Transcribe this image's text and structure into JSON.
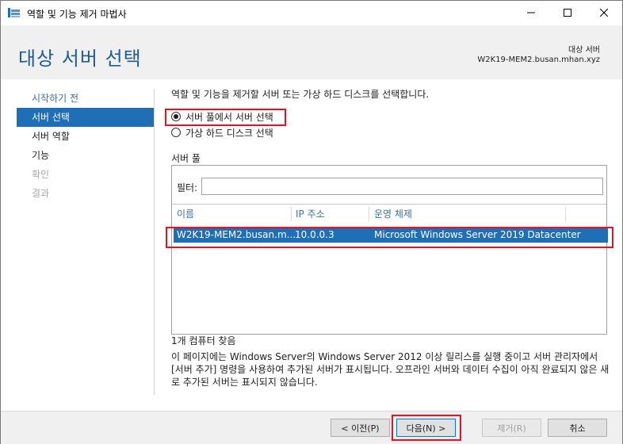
{
  "window": {
    "title": "역할 및 기능 제거 마법사",
    "controls": {
      "minimize_icon": "minimize-icon",
      "maximize_icon": "maximize-icon",
      "close_icon": "close-icon"
    }
  },
  "header": {
    "page_title": "대상 서버 선택",
    "destination_label": "대상 서버",
    "destination_value": "W2K19-MEM2.busan.mhan.xyz"
  },
  "nav": {
    "items": [
      {
        "label": "시작하기 전",
        "state": "link"
      },
      {
        "label": "서버 선택",
        "state": "active"
      },
      {
        "label": "서버 역할",
        "state": "normal"
      },
      {
        "label": "기능",
        "state": "normal"
      },
      {
        "label": "확인",
        "state": "disabled"
      },
      {
        "label": "결과",
        "state": "disabled"
      }
    ]
  },
  "main": {
    "instruction": "역할 및 기능을 제거할 서버 또는 가상 하드 디스크를 선택합니다.",
    "options": [
      {
        "label": "서버 풀에서 서버 선택",
        "selected": true
      },
      {
        "label": "가상 하드 디스크 선택",
        "selected": false
      }
    ],
    "pool_label": "서버 풀",
    "filter_label": "필터:",
    "filter_value": "",
    "columns": [
      "이름",
      "IP 주소",
      "운영 체제"
    ],
    "rows": [
      {
        "name": "W2K19-MEM2.busan.m...",
        "ip": "10.0.0.3",
        "os": "Microsoft Windows Server 2019 Datacenter"
      }
    ],
    "found_text": "1개 컴퓨터 찾음",
    "note": "이 페이지에는 Windows Server의 Windows Server 2012 이상 릴리스를 실행 중이고 서버 관리자에서 [서버 추가] 명령을 사용하여 추가된 서버가 표시됩니다. 오프라인 서버와 데이터 수집이 아직 완료되지 않은 새로 추가된 서버는 표시되지 않습니다."
  },
  "footer": {
    "prev_label": "< 이전(P)",
    "next_label": "다음(N) >",
    "remove_label": "제거(R)",
    "cancel_label": "취소"
  },
  "colors": {
    "accent": "#1e6fb5",
    "title": "#1e5c96",
    "highlight": "#e81123",
    "header_bg": "#f0f0f0"
  }
}
